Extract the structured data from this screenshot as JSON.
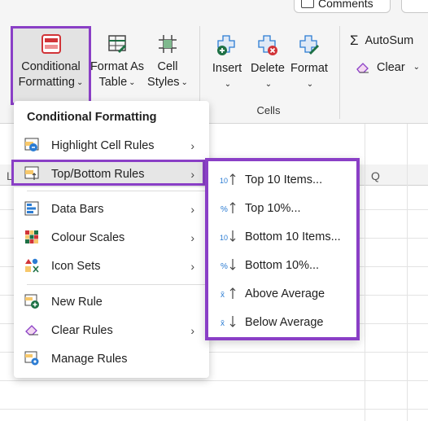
{
  "top_buttons": {
    "comments_label": "Comments"
  },
  "ribbon": {
    "conditional_formatting": {
      "line1": "Conditional",
      "line2": "Formatting"
    },
    "format_as_table": {
      "line1": "Format As",
      "line2": "Table"
    },
    "cell_styles": {
      "line1": "Cell",
      "line2": "Styles"
    },
    "insert": "Insert",
    "delete": "Delete",
    "format": "Format",
    "cells_group": "Cells",
    "autosum": "AutoSum",
    "clear": "Clear"
  },
  "grid": {
    "col_partial_left": "L",
    "col_right": "Q"
  },
  "menu": {
    "title": "Conditional Formatting",
    "items": [
      {
        "label": "Highlight Cell Rules",
        "icon": "highlight-cells-icon",
        "submenu": true
      },
      {
        "label": "Top/Bottom Rules",
        "icon": "top-bottom-icon",
        "submenu": true
      },
      {
        "label": "Data Bars",
        "icon": "data-bars-icon",
        "submenu": true
      },
      {
        "label": "Colour Scales",
        "icon": "colour-scales-icon",
        "submenu": true
      },
      {
        "label": "Icon Sets",
        "icon": "icon-sets-icon",
        "submenu": true
      },
      {
        "label": "New Rule",
        "icon": "new-rule-icon",
        "submenu": false
      },
      {
        "label": "Clear Rules",
        "icon": "clear-rules-icon",
        "submenu": true
      },
      {
        "label": "Manage Rules",
        "icon": "manage-rules-icon",
        "submenu": false
      }
    ]
  },
  "submenu": {
    "items": [
      {
        "label": "Top 10 Items...",
        "glyph": "10",
        "icon": "top-10-items-icon"
      },
      {
        "label": "Top 10%...",
        "glyph": "%",
        "icon": "top-10-percent-icon"
      },
      {
        "label": "Bottom 10 Items...",
        "glyph": "10",
        "icon": "bottom-10-items-icon"
      },
      {
        "label": "Bottom 10%...",
        "glyph": "%",
        "icon": "bottom-10-percent-icon"
      },
      {
        "label": "Above Average",
        "glyph": "x̄",
        "icon": "above-average-icon"
      },
      {
        "label": "Below Average",
        "glyph": "x̄",
        "icon": "below-average-icon"
      }
    ]
  },
  "colors": {
    "accent_purple": "#8a3fc6",
    "excel_green": "#1e7145",
    "red": "#d13438",
    "blue": "#2b7cd3"
  }
}
